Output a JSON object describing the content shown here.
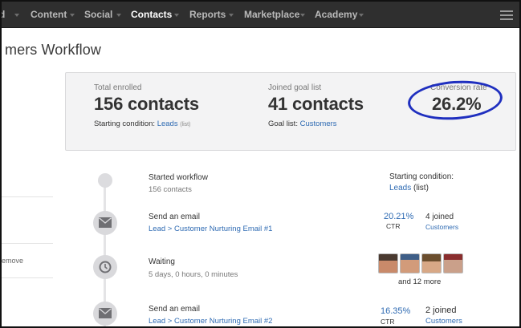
{
  "nav": {
    "partial_first": "d",
    "items": [
      {
        "label": "Content",
        "active": false
      },
      {
        "label": "Social",
        "active": false
      },
      {
        "label": "Contacts",
        "active": true
      },
      {
        "label": "Reports",
        "active": false
      },
      {
        "label": "Marketplace",
        "active": false
      },
      {
        "label": "Academy",
        "active": false
      }
    ],
    "menu_icon": "hamburger-icon"
  },
  "page": {
    "title": "mers Workflow"
  },
  "sidebar": {
    "remove_text": "emove"
  },
  "stats": {
    "enrolled": {
      "label": "Total enrolled",
      "value": "156 contacts",
      "sub_prefix": "Starting condition:",
      "sub_link": "Leads",
      "sub_suffix": "(list)"
    },
    "goal": {
      "label": "Joined goal list",
      "value": "41 contacts",
      "sub_prefix": "Goal list:",
      "sub_link": "Customers"
    },
    "conversion": {
      "label": "Conversion rate",
      "value": "26.2%"
    },
    "annotation_color": "#1f2fbf"
  },
  "timeline": {
    "steps": [
      {
        "icon": "start-dot",
        "title": "Started workflow",
        "sub": "156 contacts",
        "right_title": "Starting condition:",
        "right_link": "Leads",
        "right_suffix": "(list)"
      },
      {
        "icon": "envelope-icon",
        "title": "Send an email",
        "link": "Lead > Customer Nurturing Email #1",
        "pct": "20.21%",
        "ctr": "CTR",
        "joined": "4 joined",
        "joined_link": "Customers"
      },
      {
        "icon": "clock-icon",
        "title": "Waiting",
        "sub": "5 days, 0 hours, 0 minutes",
        "more": "and 12 more"
      },
      {
        "icon": "envelope-icon",
        "title": "Send an email",
        "link": "Lead > Customer Nurturing Email #2",
        "pct": "16.35%",
        "ctr": "CTR",
        "joined": "2 joined",
        "joined_link": "Customers"
      }
    ]
  },
  "colors": {
    "nav_bg": "#2f2f2f",
    "link": "#2f6bb3",
    "panel_bg": "#f3f3f4"
  }
}
